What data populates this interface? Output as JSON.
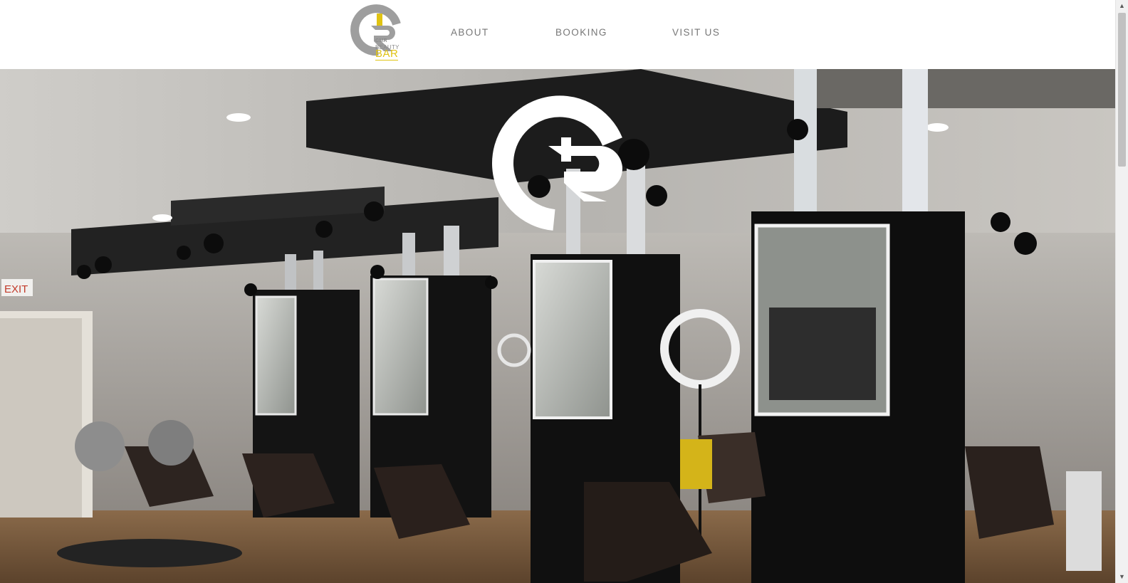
{
  "logo": {
    "line1": "CMR",
    "line2": "BEAUTY",
    "line3": "BAR"
  },
  "nav": {
    "about": "ABOUT",
    "booking": "BOOKING",
    "visit": "VISIT US"
  },
  "hero": {
    "exit_sign": "EXIT",
    "overlay_mark": "CR monogram"
  },
  "colors": {
    "accent": "#e0c312",
    "logo_gray": "#9a9a9a",
    "nav_text": "#777777"
  },
  "icons": {
    "scroll_up": "arrow-up-icon",
    "scroll_down": "arrow-down-icon"
  }
}
